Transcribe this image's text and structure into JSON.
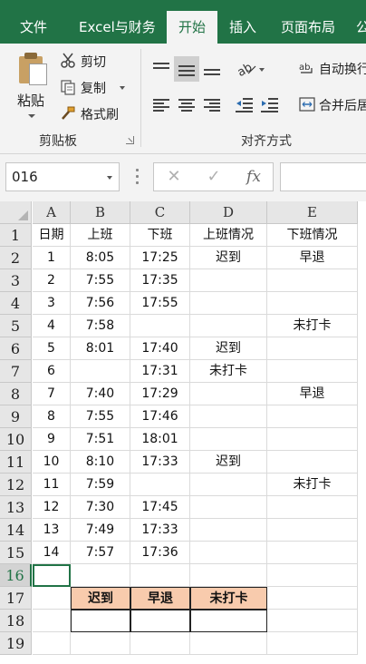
{
  "ribbon": {
    "tabs": [
      "文件",
      "Excel与财务",
      "开始",
      "插入",
      "页面布局",
      "公"
    ],
    "active_tab": "开始",
    "clipboard": {
      "group_label": "剪贴板",
      "paste_label": "粘贴",
      "cut_label": "剪切",
      "copy_label": "复制",
      "format_painter_label": "格式刷"
    },
    "alignment": {
      "group_label": "对齐方式",
      "wrap_text_label": "自动换行",
      "merge_center_label": "合并后居"
    },
    "accent_color": "#217346"
  },
  "formula_bar": {
    "name_box_value": "016",
    "cancel_glyph": "✕",
    "enter_glyph": "✓",
    "fx_label": "fx",
    "formula_value": ""
  },
  "sheet": {
    "columns": [
      "A",
      "B",
      "C",
      "D",
      "E"
    ],
    "rows": [
      "1",
      "2",
      "3",
      "4",
      "5",
      "6",
      "7",
      "8",
      "9",
      "10",
      "11",
      "12",
      "13",
      "14",
      "15",
      "16",
      "17",
      "18",
      "19"
    ],
    "selected_row": "16",
    "header_row": [
      "日期",
      "上班",
      "下班",
      "上班情况",
      "下班情况"
    ],
    "data_rows": [
      [
        "1",
        "8:05",
        "17:25",
        "迟到",
        "早退"
      ],
      [
        "2",
        "7:55",
        "17:35",
        "",
        ""
      ],
      [
        "3",
        "7:56",
        "17:55",
        "",
        ""
      ],
      [
        "4",
        "7:58",
        "",
        "",
        "未打卡"
      ],
      [
        "5",
        "8:01",
        "17:40",
        "迟到",
        ""
      ],
      [
        "6",
        "",
        "17:31",
        "未打卡",
        ""
      ],
      [
        "7",
        "7:40",
        "17:29",
        "",
        "早退"
      ],
      [
        "8",
        "7:55",
        "17:46",
        "",
        ""
      ],
      [
        "9",
        "7:51",
        "18:01",
        "",
        ""
      ],
      [
        "10",
        "8:10",
        "17:33",
        "迟到",
        ""
      ],
      [
        "11",
        "7:59",
        "",
        "",
        "未打卡"
      ],
      [
        "12",
        "7:30",
        "17:45",
        "",
        ""
      ],
      [
        "13",
        "7:49",
        "17:33",
        "",
        ""
      ],
      [
        "14",
        "7:57",
        "17:36",
        "",
        ""
      ]
    ],
    "summary_headers": [
      "迟到",
      "早退",
      "未打卡"
    ],
    "summary_values": [
      "",
      "",
      ""
    ],
    "summary_header_fill": "#f8cbad"
  }
}
